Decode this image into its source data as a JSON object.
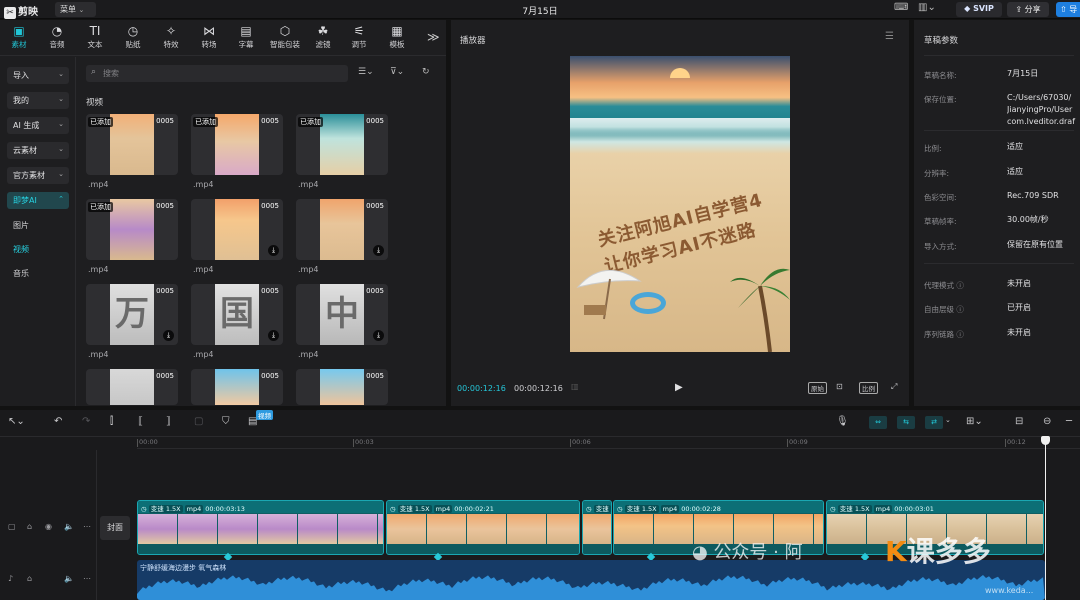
{
  "app": {
    "logo_text": "剪映",
    "menu_label": "菜单",
    "doc_title": "7月15日",
    "svip_label": "SVIP",
    "share_label": "分享",
    "export_label": "导"
  },
  "tool_tabs": [
    {
      "label": "素材",
      "icon": "▣"
    },
    {
      "label": "音频",
      "icon": "◔"
    },
    {
      "label": "文本",
      "icon": "TI"
    },
    {
      "label": "贴纸",
      "icon": "◷"
    },
    {
      "label": "特效",
      "icon": "✧"
    },
    {
      "label": "转场",
      "icon": "⋈"
    },
    {
      "label": "字幕",
      "icon": "▤"
    },
    {
      "label": "智能包装",
      "icon": "⬡"
    },
    {
      "label": "滤镜",
      "icon": "☘"
    },
    {
      "label": "调节",
      "icon": "⚟"
    },
    {
      "label": "模板",
      "icon": "▦"
    }
  ],
  "tool_tabs_more": "≫",
  "categories": [
    {
      "label": "导入"
    },
    {
      "label": "我的"
    },
    {
      "label": "AI 生成"
    },
    {
      "label": "云素材"
    },
    {
      "label": "官方素材"
    },
    {
      "label": "即梦AI"
    }
  ],
  "sub_items": [
    "图片",
    "视频",
    "音乐"
  ],
  "search": {
    "placeholder": "搜索"
  },
  "section_title": "视频",
  "media": [
    {
      "badge": "已添加",
      "duration": "0005",
      "name": ".mp4"
    },
    {
      "badge": "已添加",
      "duration": "0005",
      "name": ".mp4"
    },
    {
      "badge": "已添加",
      "duration": "0005",
      "name": ".mp4"
    },
    {
      "badge": "已添加",
      "duration": "0005",
      "name": ".mp4"
    },
    {
      "badge": "",
      "duration": "0005",
      "name": ".mp4"
    },
    {
      "badge": "",
      "duration": "0005",
      "name": ".mp4"
    },
    {
      "badge": "",
      "duration": "0005",
      "name": ".mp4",
      "char": "万"
    },
    {
      "badge": "",
      "duration": "0005",
      "name": ".mp4",
      "char": "国"
    },
    {
      "badge": "",
      "duration": "0005",
      "name": ".mp4",
      "char": "中"
    },
    {
      "badge": "",
      "duration": "0005",
      "name": ""
    },
    {
      "badge": "",
      "duration": "0005",
      "name": ""
    },
    {
      "badge": "",
      "duration": "0005",
      "name": ""
    }
  ],
  "player": {
    "title": "播放器",
    "text_line1": "关注阿旭AI自学营4",
    "text_line2": "让你学习AI不迷路",
    "time_current": "00:00:12:16",
    "time_total": "00:00:12:16",
    "btn_original": "原始",
    "btn_ratio": "比例"
  },
  "properties": {
    "title": "草稿参数",
    "rows": [
      {
        "label": "草稿名称:",
        "value": "7月15日"
      },
      {
        "label": "保存位置:",
        "value": "C:/Users/67030/\nJianyingPro/User\ncom.lveditor.draf"
      },
      {
        "label": "比例:",
        "value": "适应"
      },
      {
        "label": "分辨率:",
        "value": "适应"
      },
      {
        "label": "色彩空间:",
        "value": "Rec.709 SDR"
      },
      {
        "label": "草稿帧率:",
        "value": "30.00帧/秒"
      },
      {
        "label": "导入方式:",
        "value": "保留在原有位置"
      },
      {
        "label": "代理模式",
        "value": "未开启"
      },
      {
        "label": "自由层级",
        "value": "已开启"
      },
      {
        "label": "序列链路",
        "value": "未开启"
      }
    ]
  },
  "timeline": {
    "tag_label": "视频",
    "ticks": [
      "00:00",
      "00:03",
      "00:06",
      "00:09",
      "00:12"
    ],
    "cover_label": "封面",
    "clips": [
      {
        "speed": "变速 1.5X",
        "fmt": "mp4",
        "dur": "00:00:03:13"
      },
      {
        "speed": "变速 1.5X",
        "fmt": "mp4",
        "dur": "00:00:02:21"
      },
      {
        "speed": "变速",
        "fmt": "",
        "dur": ""
      },
      {
        "speed": "变速 1.5X",
        "fmt": "mp4",
        "dur": "00:00:02:28"
      },
      {
        "speed": "变速 1.5X",
        "fmt": "mp4",
        "dur": "00:00:03:01"
      }
    ],
    "audio_label": "宁静舒缓海边漫步  氧气森林"
  },
  "watermark": {
    "text": "公众号 · 阿",
    "brand_k": "K",
    "brand_rest": "课多多",
    "url": "www.keda..."
  }
}
